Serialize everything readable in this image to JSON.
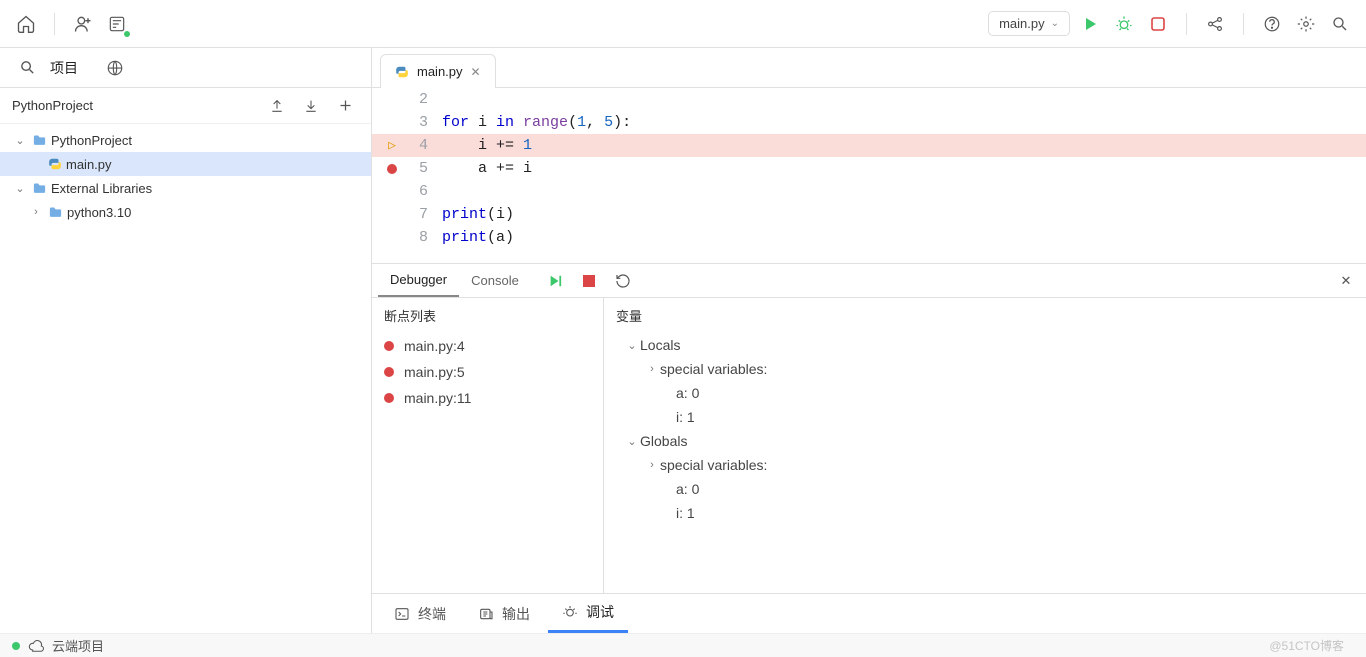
{
  "topbar": {
    "config_name": "main.py"
  },
  "sidebar": {
    "project_label": "项目",
    "project_root": "PythonProject",
    "tree": [
      {
        "label": "PythonProject",
        "type": "folder",
        "depth": 0,
        "expanded": true,
        "selected": false
      },
      {
        "label": "main.py",
        "type": "python",
        "depth": 1,
        "expanded": false,
        "selected": true
      },
      {
        "label": "External Libraries",
        "type": "folder",
        "depth": 0,
        "expanded": true,
        "selected": false
      },
      {
        "label": "python3.10",
        "type": "folder",
        "depth": 1,
        "expanded": false,
        "selected": false
      }
    ]
  },
  "editor": {
    "tab_name": "main.py",
    "lines": [
      {
        "n": 2,
        "gutter": "",
        "current": false,
        "tokens": []
      },
      {
        "n": 3,
        "gutter": "",
        "current": false,
        "tokens": [
          {
            "t": "for ",
            "c": "kw"
          },
          {
            "t": "i ",
            "c": ""
          },
          {
            "t": "in ",
            "c": "kw"
          },
          {
            "t": "range",
            "c": "fn"
          },
          {
            "t": "(",
            "c": ""
          },
          {
            "t": "1",
            "c": "num"
          },
          {
            "t": ", ",
            "c": ""
          },
          {
            "t": "5",
            "c": "num"
          },
          {
            "t": "):",
            "c": ""
          }
        ]
      },
      {
        "n": 4,
        "gutter": "arrow",
        "current": true,
        "tokens": [
          {
            "t": "    i += ",
            "c": ""
          },
          {
            "t": "1",
            "c": "num"
          }
        ]
      },
      {
        "n": 5,
        "gutter": "bp",
        "current": false,
        "tokens": [
          {
            "t": "    a += i",
            "c": ""
          }
        ]
      },
      {
        "n": 6,
        "gutter": "",
        "current": false,
        "tokens": []
      },
      {
        "n": 7,
        "gutter": "",
        "current": false,
        "tokens": [
          {
            "t": "print",
            "c": "kw"
          },
          {
            "t": "(i)",
            "c": ""
          }
        ]
      },
      {
        "n": 8,
        "gutter": "",
        "current": false,
        "tokens": [
          {
            "t": "print",
            "c": "kw"
          },
          {
            "t": "(a)",
            "c": ""
          }
        ]
      }
    ]
  },
  "debug": {
    "tab_debugger": "Debugger",
    "tab_console": "Console",
    "breakpoints_title": "断点列表",
    "breakpoints": [
      "main.py:4",
      "main.py:5",
      "main.py:11"
    ],
    "vars_title": "变量",
    "scopes": [
      {
        "name": "Locals",
        "expanded": true,
        "special_label": "special variables:",
        "vars": [
          {
            "k": "a",
            "v": "0"
          },
          {
            "k": "i",
            "v": "1"
          }
        ]
      },
      {
        "name": "Globals",
        "expanded": true,
        "special_label": "special variables:",
        "vars": [
          {
            "k": "a",
            "v": "0"
          },
          {
            "k": "i",
            "v": "1"
          }
        ]
      }
    ]
  },
  "bottom_tabs": {
    "terminal": "终端",
    "output": "输出",
    "debug": "调试"
  },
  "status": {
    "cloud_project": "云端项目",
    "watermark": "@51CTO博客"
  }
}
